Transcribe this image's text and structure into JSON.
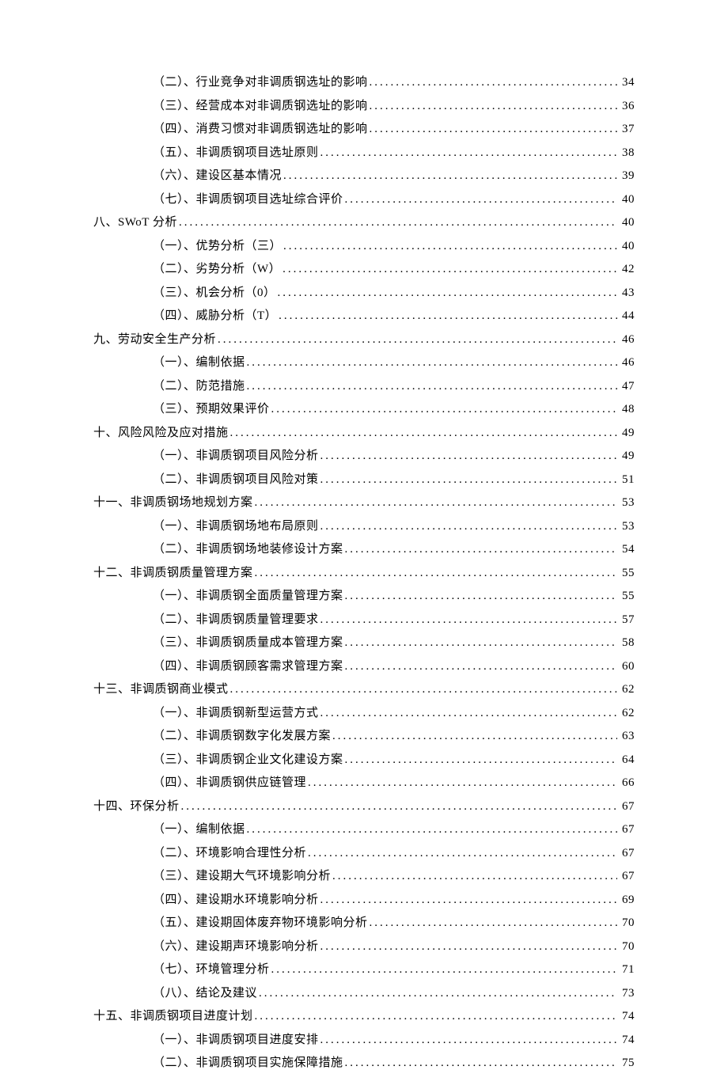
{
  "toc": [
    {
      "label": "（二）、行业竞争对非调质钢选址的影响",
      "page": "34",
      "level": 1
    },
    {
      "label": "（三）、经营成本对非调质钢选址的影响",
      "page": "36",
      "level": 1
    },
    {
      "label": "（四）、消费习惯对非调质钢选址的影响",
      "page": "37",
      "level": 1
    },
    {
      "label": "（五）、非调质钢项目选址原则",
      "page": "38",
      "level": 1
    },
    {
      "label": "（六）、建设区基本情况",
      "page": "39",
      "level": 1
    },
    {
      "label": "（七）、非调质钢项目选址综合评价",
      "page": "40",
      "level": 1
    },
    {
      "label": "八、SWoT 分析",
      "page": "40",
      "level": 0
    },
    {
      "label": "（一）、优势分析（三）",
      "page": "40",
      "level": 1
    },
    {
      "label": "（二）、劣势分析（W）",
      "page": "42",
      "level": 1
    },
    {
      "label": "（三）、机会分析（0）",
      "page": "43",
      "level": 1
    },
    {
      "label": "（四）、威胁分析（T）",
      "page": "44",
      "level": 1
    },
    {
      "label": "九、劳动安全生产分析",
      "page": "46",
      "level": 0
    },
    {
      "label": "（一）、编制依据",
      "page": "46",
      "level": 1
    },
    {
      "label": "（二）、防范措施",
      "page": "47",
      "level": 1
    },
    {
      "label": "（三）、预期效果评价",
      "page": "48",
      "level": 1
    },
    {
      "label": "十、风险风险及应对措施",
      "page": "49",
      "level": 0
    },
    {
      "label": "（一）、非调质钢项目风险分析",
      "page": "49",
      "level": 1
    },
    {
      "label": "（二）、非调质钢项目风险对策",
      "page": "51",
      "level": 1
    },
    {
      "label": "十一、非调质钢场地规划方案",
      "page": "53",
      "level": 0
    },
    {
      "label": "（一）、非调质钢场地布局原则",
      "page": "53",
      "level": 1
    },
    {
      "label": "（二）、非调质钢场地装修设计方案",
      "page": "54",
      "level": 1
    },
    {
      "label": "十二、非调质钢质量管理方案",
      "page": "55",
      "level": 0
    },
    {
      "label": "（一）、非调质钢全面质量管理方案",
      "page": "55",
      "level": 1
    },
    {
      "label": "（二）、非调质钢质量管理要求",
      "page": "57",
      "level": 1
    },
    {
      "label": "（三）、非调质钢质量成本管理方案",
      "page": "58",
      "level": 1
    },
    {
      "label": "（四）、非调质钢顾客需求管理方案",
      "page": "60",
      "level": 1
    },
    {
      "label": "十三、非调质钢商业模式",
      "page": "62",
      "level": 0
    },
    {
      "label": "（一）、非调质钢新型运营方式",
      "page": "62",
      "level": 1
    },
    {
      "label": "（二）、非调质钢数字化发展方案",
      "page": "63",
      "level": 1
    },
    {
      "label": "（三）、非调质钢企业文化建设方案",
      "page": "64",
      "level": 1
    },
    {
      "label": "（四）、非调质钢供应链管理",
      "page": "66",
      "level": 1
    },
    {
      "label": "十四、环保分析",
      "page": "67",
      "level": 0
    },
    {
      "label": "（一）、编制依据",
      "page": "67",
      "level": 1
    },
    {
      "label": "（二）、环境影响合理性分析",
      "page": "67",
      "level": 1
    },
    {
      "label": "（三）、建设期大气环境影响分析",
      "page": "67",
      "level": 1
    },
    {
      "label": "（四）、建设期水环境影响分析",
      "page": "69",
      "level": 1
    },
    {
      "label": "（五）、建设期固体废弃物环境影响分析",
      "page": "70",
      "level": 1
    },
    {
      "label": "（六）、建设期声环境影响分析",
      "page": "70",
      "level": 1
    },
    {
      "label": "（七）、环境管理分析",
      "page": "71",
      "level": 1
    },
    {
      "label": "（八）、结论及建议",
      "page": "73",
      "level": 1
    },
    {
      "label": "十五、非调质钢项目进度计划",
      "page": "74",
      "level": 0
    },
    {
      "label": "（一）、非调质钢项目进度安排",
      "page": "74",
      "level": 1
    },
    {
      "label": "（二）、非调质钢项目实施保障措施",
      "page": "75",
      "level": 1
    }
  ]
}
